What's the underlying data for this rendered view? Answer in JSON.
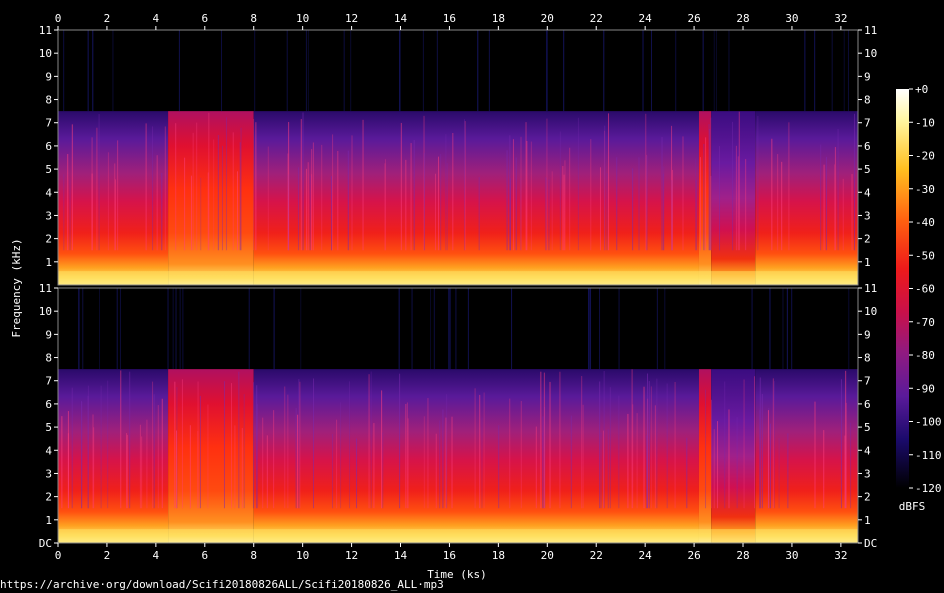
{
  "chart_data": {
    "type": "heatmap",
    "title": "",
    "xlabel": "Time (ks)",
    "ylabel": "Frequency (kHz)",
    "colorbar_label": "dBFS",
    "x_ticks": [
      0,
      2,
      4,
      6,
      8,
      10,
      12,
      14,
      16,
      18,
      20,
      22,
      24,
      26,
      28,
      30,
      32
    ],
    "xlim": [
      0,
      32.7
    ],
    "ylim": [
      0,
      11
    ],
    "y_ticks_top": [
      "11",
      "10",
      "9",
      "8",
      "7",
      "6",
      "5",
      "4",
      "3",
      "2",
      "1"
    ],
    "y_ticks_bottom": [
      "11",
      "10",
      "9",
      "8",
      "7",
      "6",
      "5",
      "4",
      "3",
      "2",
      "1",
      "DC"
    ],
    "colorbar_ticks": [
      "+0",
      "-10",
      "-20",
      "-30",
      "-40",
      "-50",
      "-60",
      "-70",
      "-80",
      "-90",
      "-100",
      "-110",
      "-120"
    ],
    "colorbar_range": [
      -120,
      0
    ],
    "channels": 2,
    "energy_cutoff_khz": 7.5,
    "segments": [
      {
        "start": 0,
        "end": 4.5,
        "level": "medium"
      },
      {
        "start": 4.5,
        "end": 8,
        "level": "high"
      },
      {
        "start": 8,
        "end": 26.2,
        "level": "medium-low"
      },
      {
        "start": 26.2,
        "end": 26.7,
        "level": "high"
      },
      {
        "start": 26.7,
        "end": 28.5,
        "level": "low"
      },
      {
        "start": 28.5,
        "end": 32.7,
        "level": "medium"
      }
    ],
    "colors": {
      "background": "#000000",
      "text": "#ffffff",
      "frame": "#888888"
    }
  },
  "footer": {
    "source_url": "https://archive·org/download/Scifi20180826ALL/Scifi20180826_ALL·mp3"
  }
}
